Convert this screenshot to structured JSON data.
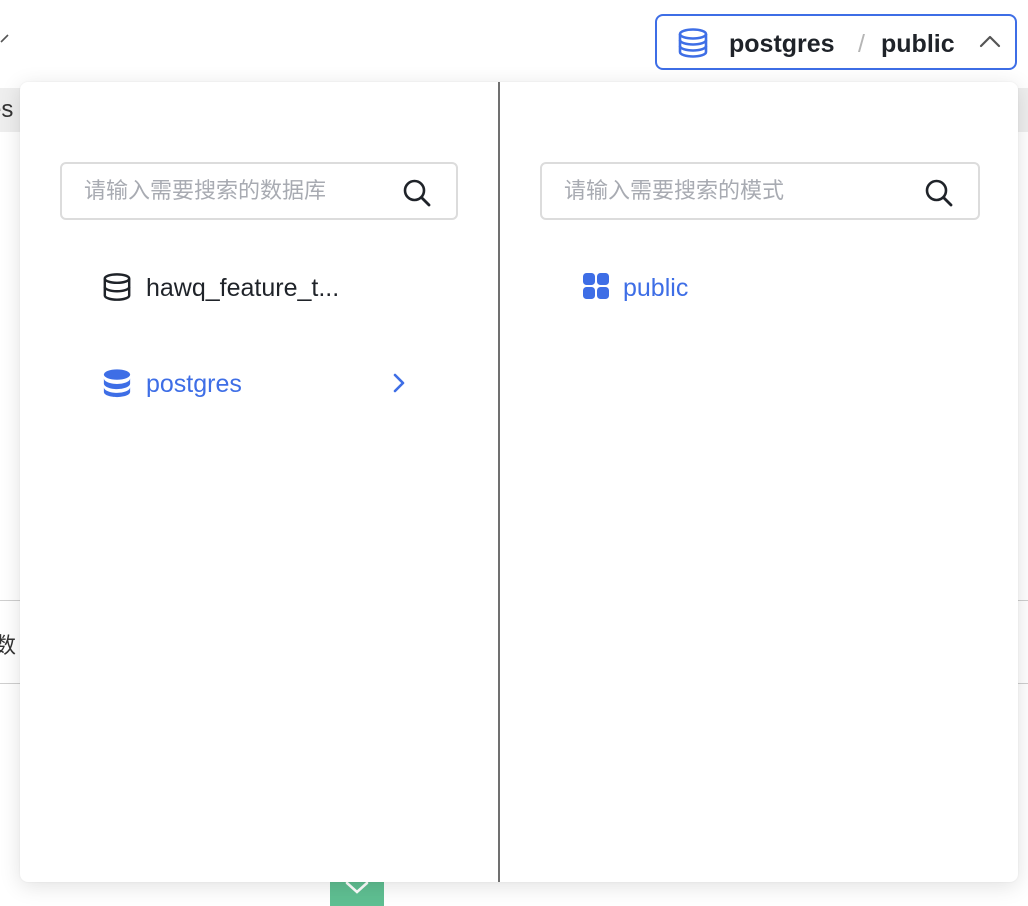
{
  "selector": {
    "database": "postgres",
    "separator": "/",
    "schema": "public"
  },
  "database_panel": {
    "search_placeholder": "请输入需要搜索的数据库",
    "items": [
      {
        "label": "hawq_feature_t...",
        "icon": "database-icon",
        "selected": false
      },
      {
        "label": "postgres",
        "icon": "database-icon",
        "selected": true
      }
    ]
  },
  "schema_panel": {
    "search_placeholder": "请输入需要搜索的模式",
    "items": [
      {
        "label": "public",
        "icon": "schema-grid-icon",
        "selected": true
      }
    ]
  },
  "background": {
    "partial_text_1": "es",
    "partial_text_2": "数"
  },
  "colors": {
    "accent": "#3e6ee6",
    "text": "#1f2329",
    "placeholder": "#a8abb2",
    "border": "#dcdcdc",
    "success": "#5fbf92"
  }
}
